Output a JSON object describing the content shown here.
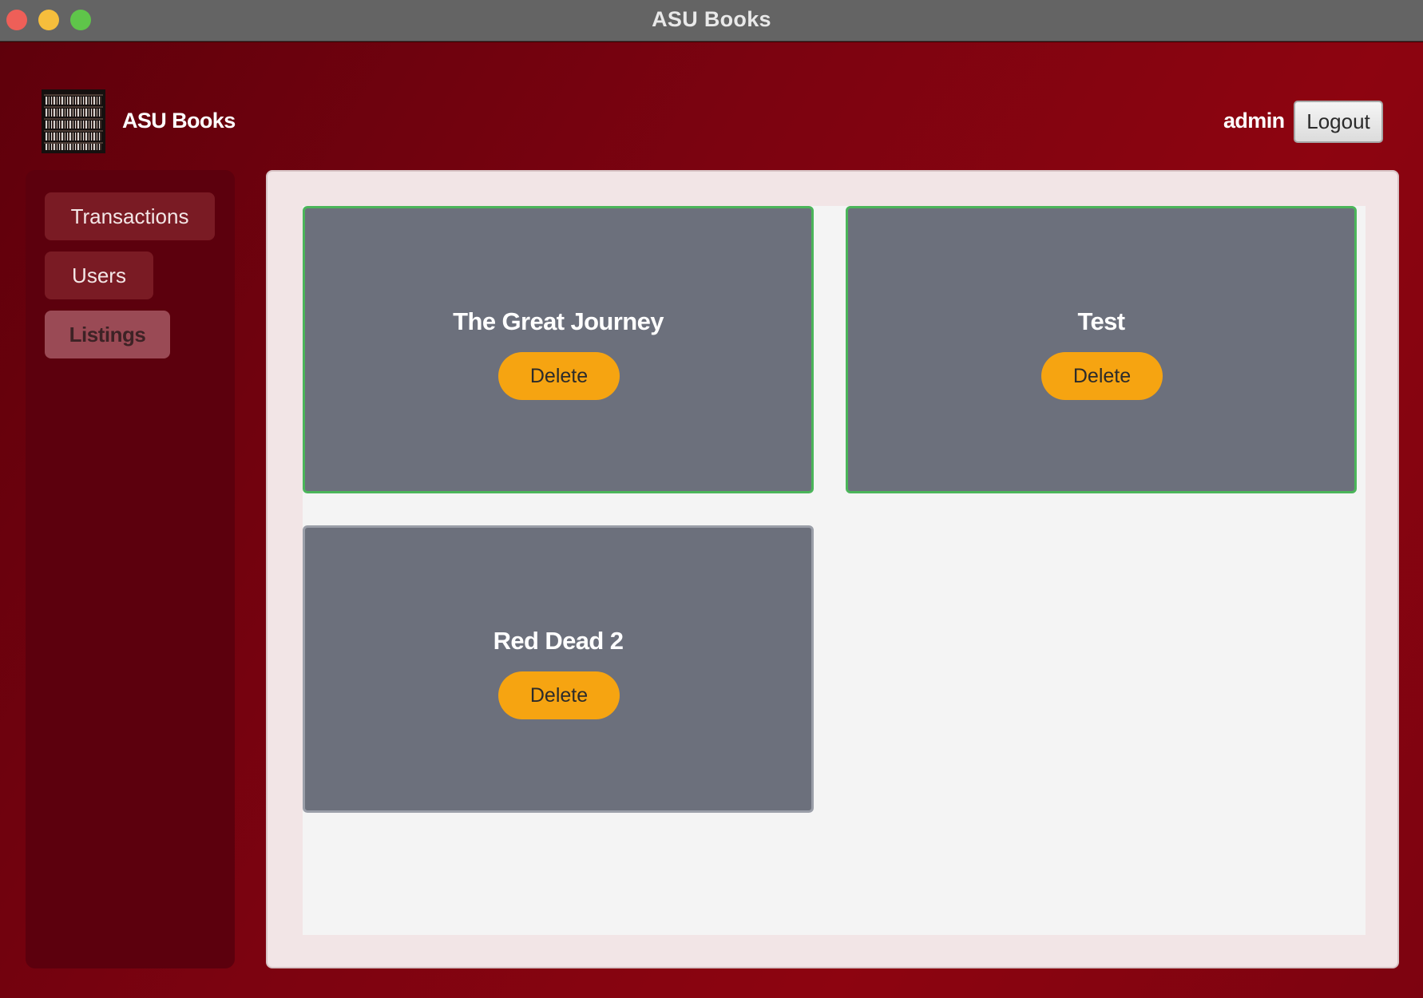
{
  "window": {
    "title": "ASU Books",
    "controls": [
      "close",
      "minimize",
      "zoom"
    ]
  },
  "header": {
    "logo_icon": "bookshelf-logo-icon",
    "brand": "ASU Books",
    "username": "admin",
    "logout_label": "Logout"
  },
  "sidebar": {
    "items": [
      {
        "label": "Transactions",
        "active": false
      },
      {
        "label": "Users",
        "active": false
      },
      {
        "label": "Listings",
        "active": true
      }
    ]
  },
  "listings": [
    {
      "title": "The Great Journey",
      "action": "Delete",
      "border_color": "#4bb55a"
    },
    {
      "title": "Test",
      "action": "Delete",
      "border_color": "#4bb55a"
    },
    {
      "title": "Red Dead 2",
      "action": "Delete",
      "border_color": "#9a9ea8"
    }
  ],
  "colors": {
    "background": "#8d0410",
    "sidebar": "#5c000d",
    "card": "#6c707c",
    "delete_button": "#f6a411",
    "available_border": "#4bb55a"
  }
}
